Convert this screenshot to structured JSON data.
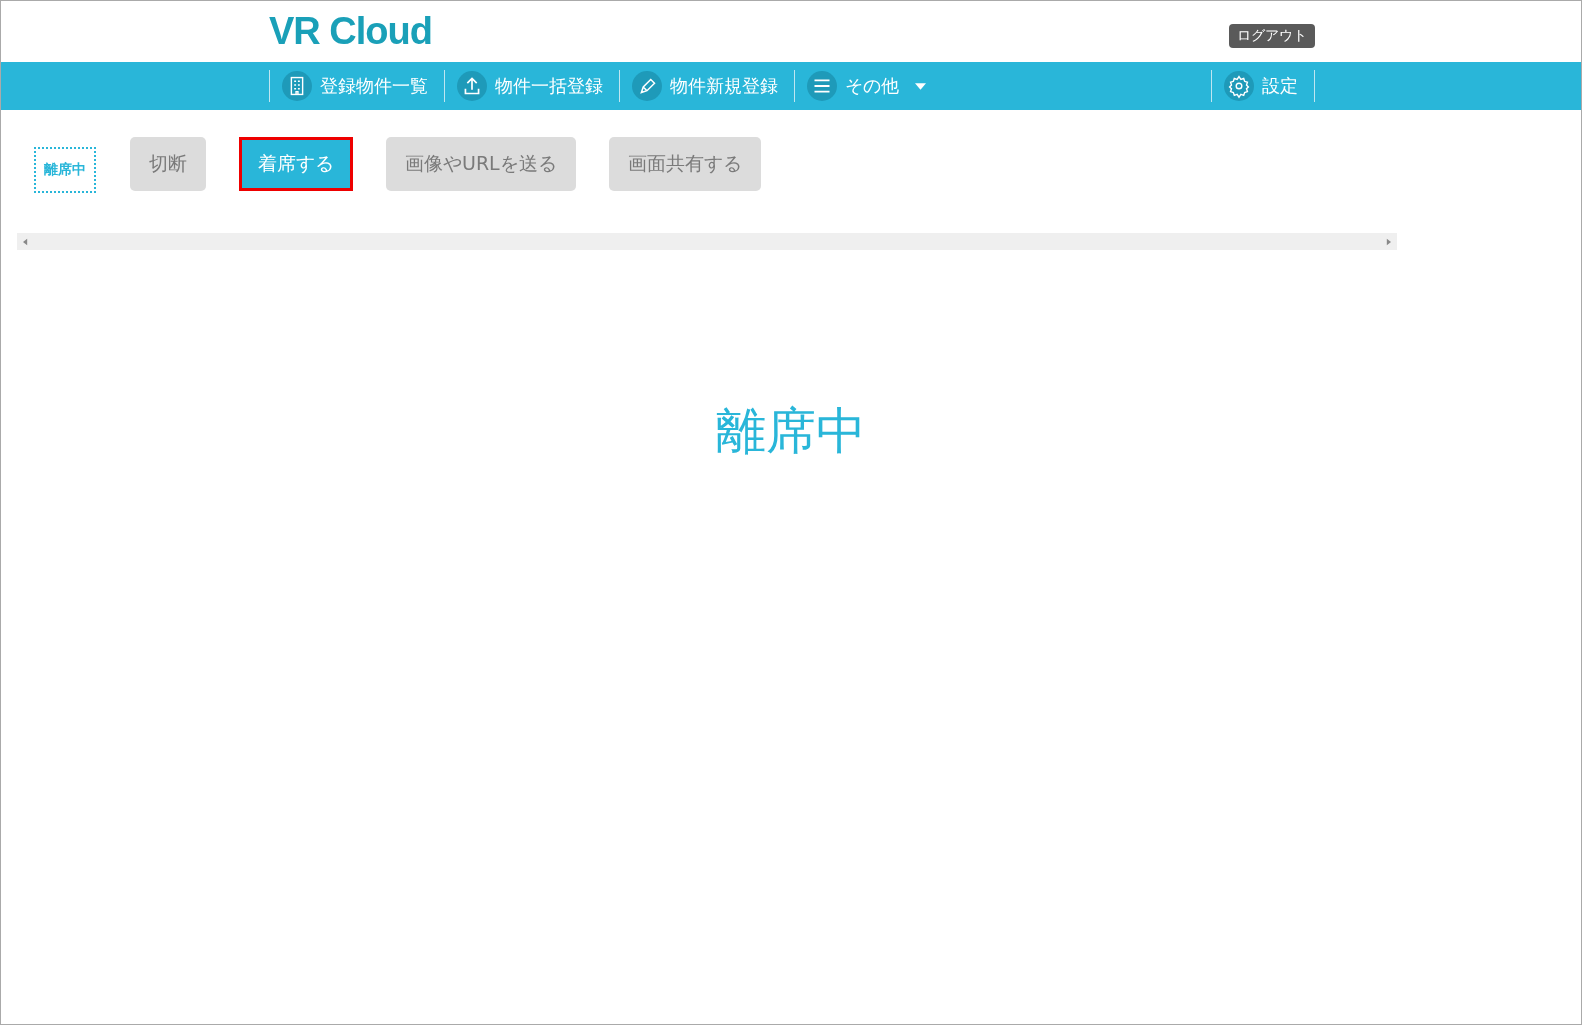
{
  "header": {
    "logo": "VR Cloud",
    "logout": "ログアウト"
  },
  "nav": {
    "items": [
      {
        "label": "登録物件一覧",
        "kind": "building"
      },
      {
        "label": "物件一括登録",
        "kind": "upload"
      },
      {
        "label": "物件新規登録",
        "kind": "pencil"
      },
      {
        "label": "その他",
        "kind": "menu",
        "dropdown": true
      }
    ],
    "settings": {
      "label": "設定",
      "kind": "gear"
    }
  },
  "status_badge": "離席中",
  "actions": [
    {
      "label": "切断",
      "disabled": true,
      "highlighted": false
    },
    {
      "label": "着席する",
      "disabled": false,
      "highlighted": true
    },
    {
      "label": "画像やURLを送る",
      "disabled": true,
      "highlighted": false
    },
    {
      "label": "画面共有する",
      "disabled": true,
      "highlighted": false
    }
  ],
  "status_message": "離席中"
}
